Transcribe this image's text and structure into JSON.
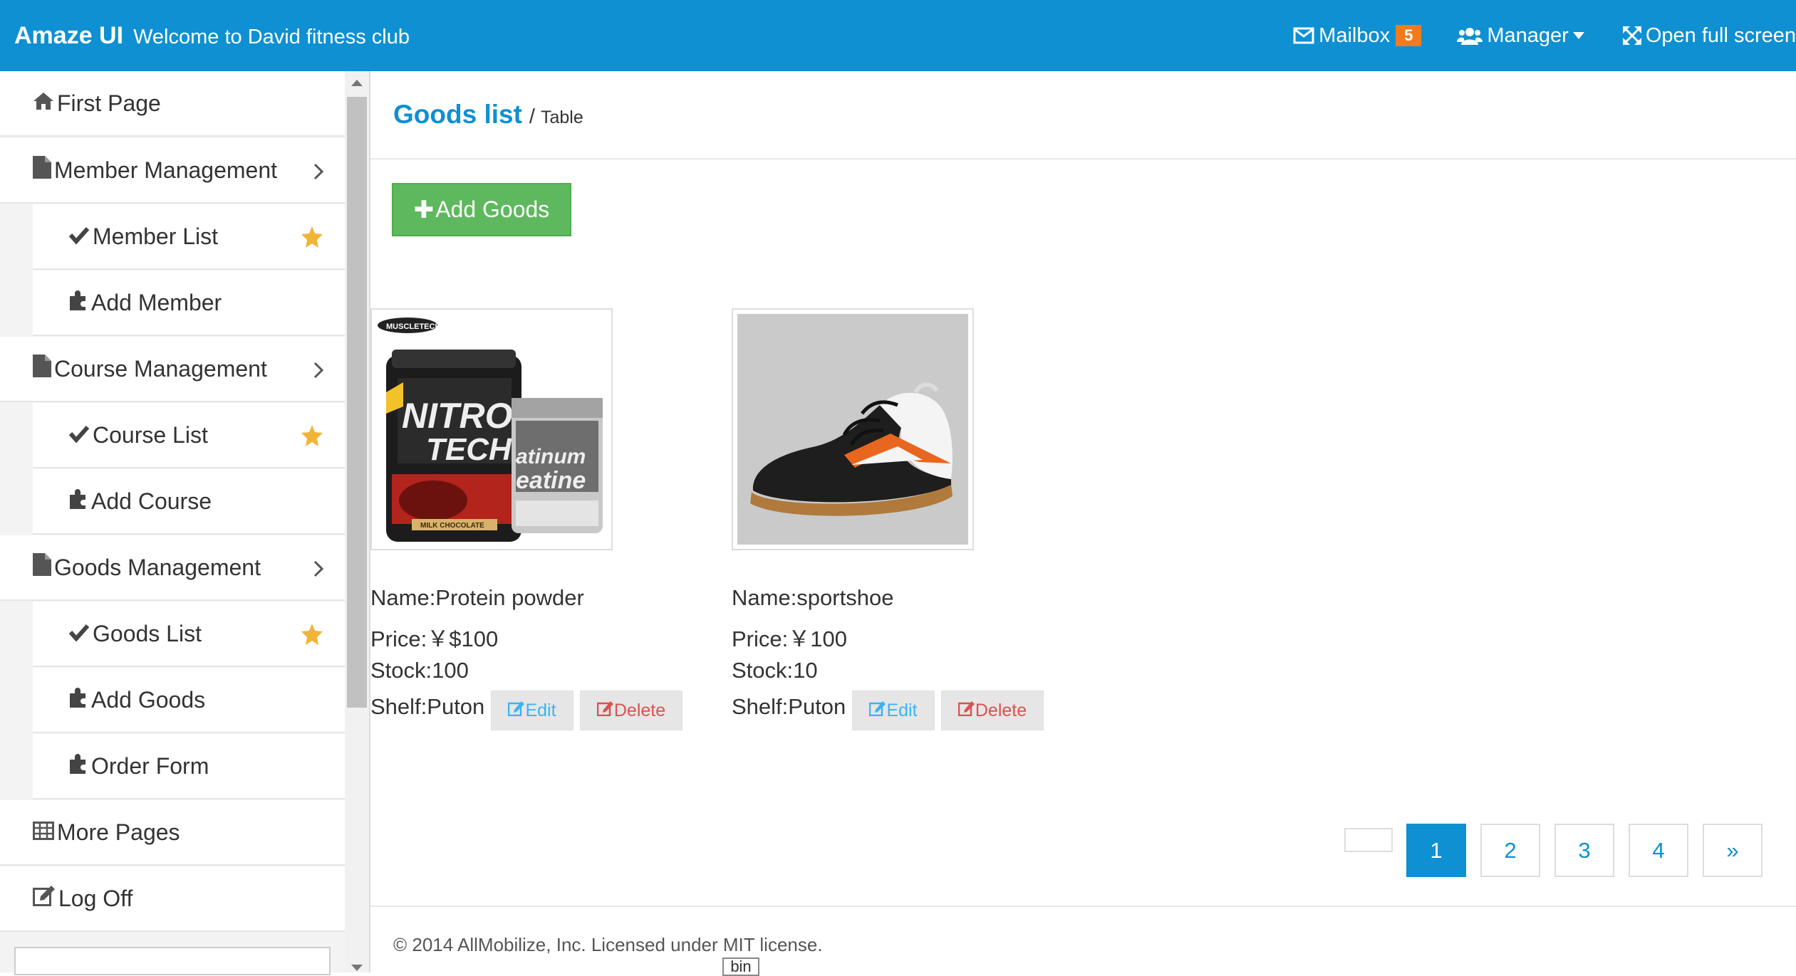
{
  "header": {
    "brand": "Amaze UI",
    "welcome": "Welcome to David fitness club",
    "mailbox_label": "Mailbox",
    "mailbox_count": "5",
    "manager_label": "Manager",
    "fullscreen_label": "Open full screen",
    "bar_color": "#0e90d2"
  },
  "sidebar": {
    "items": [
      {
        "label": "First Page",
        "icon": "home-icon"
      },
      {
        "label": "Member Management",
        "icon": "file-icon"
      },
      {
        "label": "Member List",
        "icon": "check-icon"
      },
      {
        "label": "Add Member",
        "icon": "puzzle-icon"
      },
      {
        "label": "Course Management",
        "icon": "file-icon"
      },
      {
        "label": "Course List",
        "icon": "check-icon"
      },
      {
        "label": "Add Course",
        "icon": "puzzle-icon"
      },
      {
        "label": "Goods Management",
        "icon": "file-icon"
      },
      {
        "label": "Goods List",
        "icon": "check-icon"
      },
      {
        "label": "Add Goods",
        "icon": "puzzle-icon"
      },
      {
        "label": "Order Form",
        "icon": "puzzle-icon"
      },
      {
        "label": "More Pages",
        "icon": "table-icon"
      },
      {
        "label": "Log Off",
        "icon": "edit-icon"
      }
    ]
  },
  "main": {
    "breadcrumb_title": "Goods list",
    "breadcrumb_sep": "/",
    "breadcrumb_sub": "Table",
    "add_button_label": "Add Goods",
    "goods": [
      {
        "name": "Name:Protein powder",
        "price": "Price:￥$100",
        "stock": "Stock:100",
        "shelf": "Shelf:Puton",
        "edit": "Edit",
        "delete": "Delete"
      },
      {
        "name": "Name:sportshoe",
        "price": "Price:￥100",
        "stock": "Stock:10",
        "shelf": "Shelf:Puton",
        "edit": "Edit",
        "delete": "Delete"
      }
    ],
    "pagination": [
      "1",
      "2",
      "3",
      "4",
      "»"
    ],
    "active_page": "1",
    "footer": "© 2014 AllMobilize, Inc. Licensed under MIT license.",
    "bin_tag": "bin"
  }
}
